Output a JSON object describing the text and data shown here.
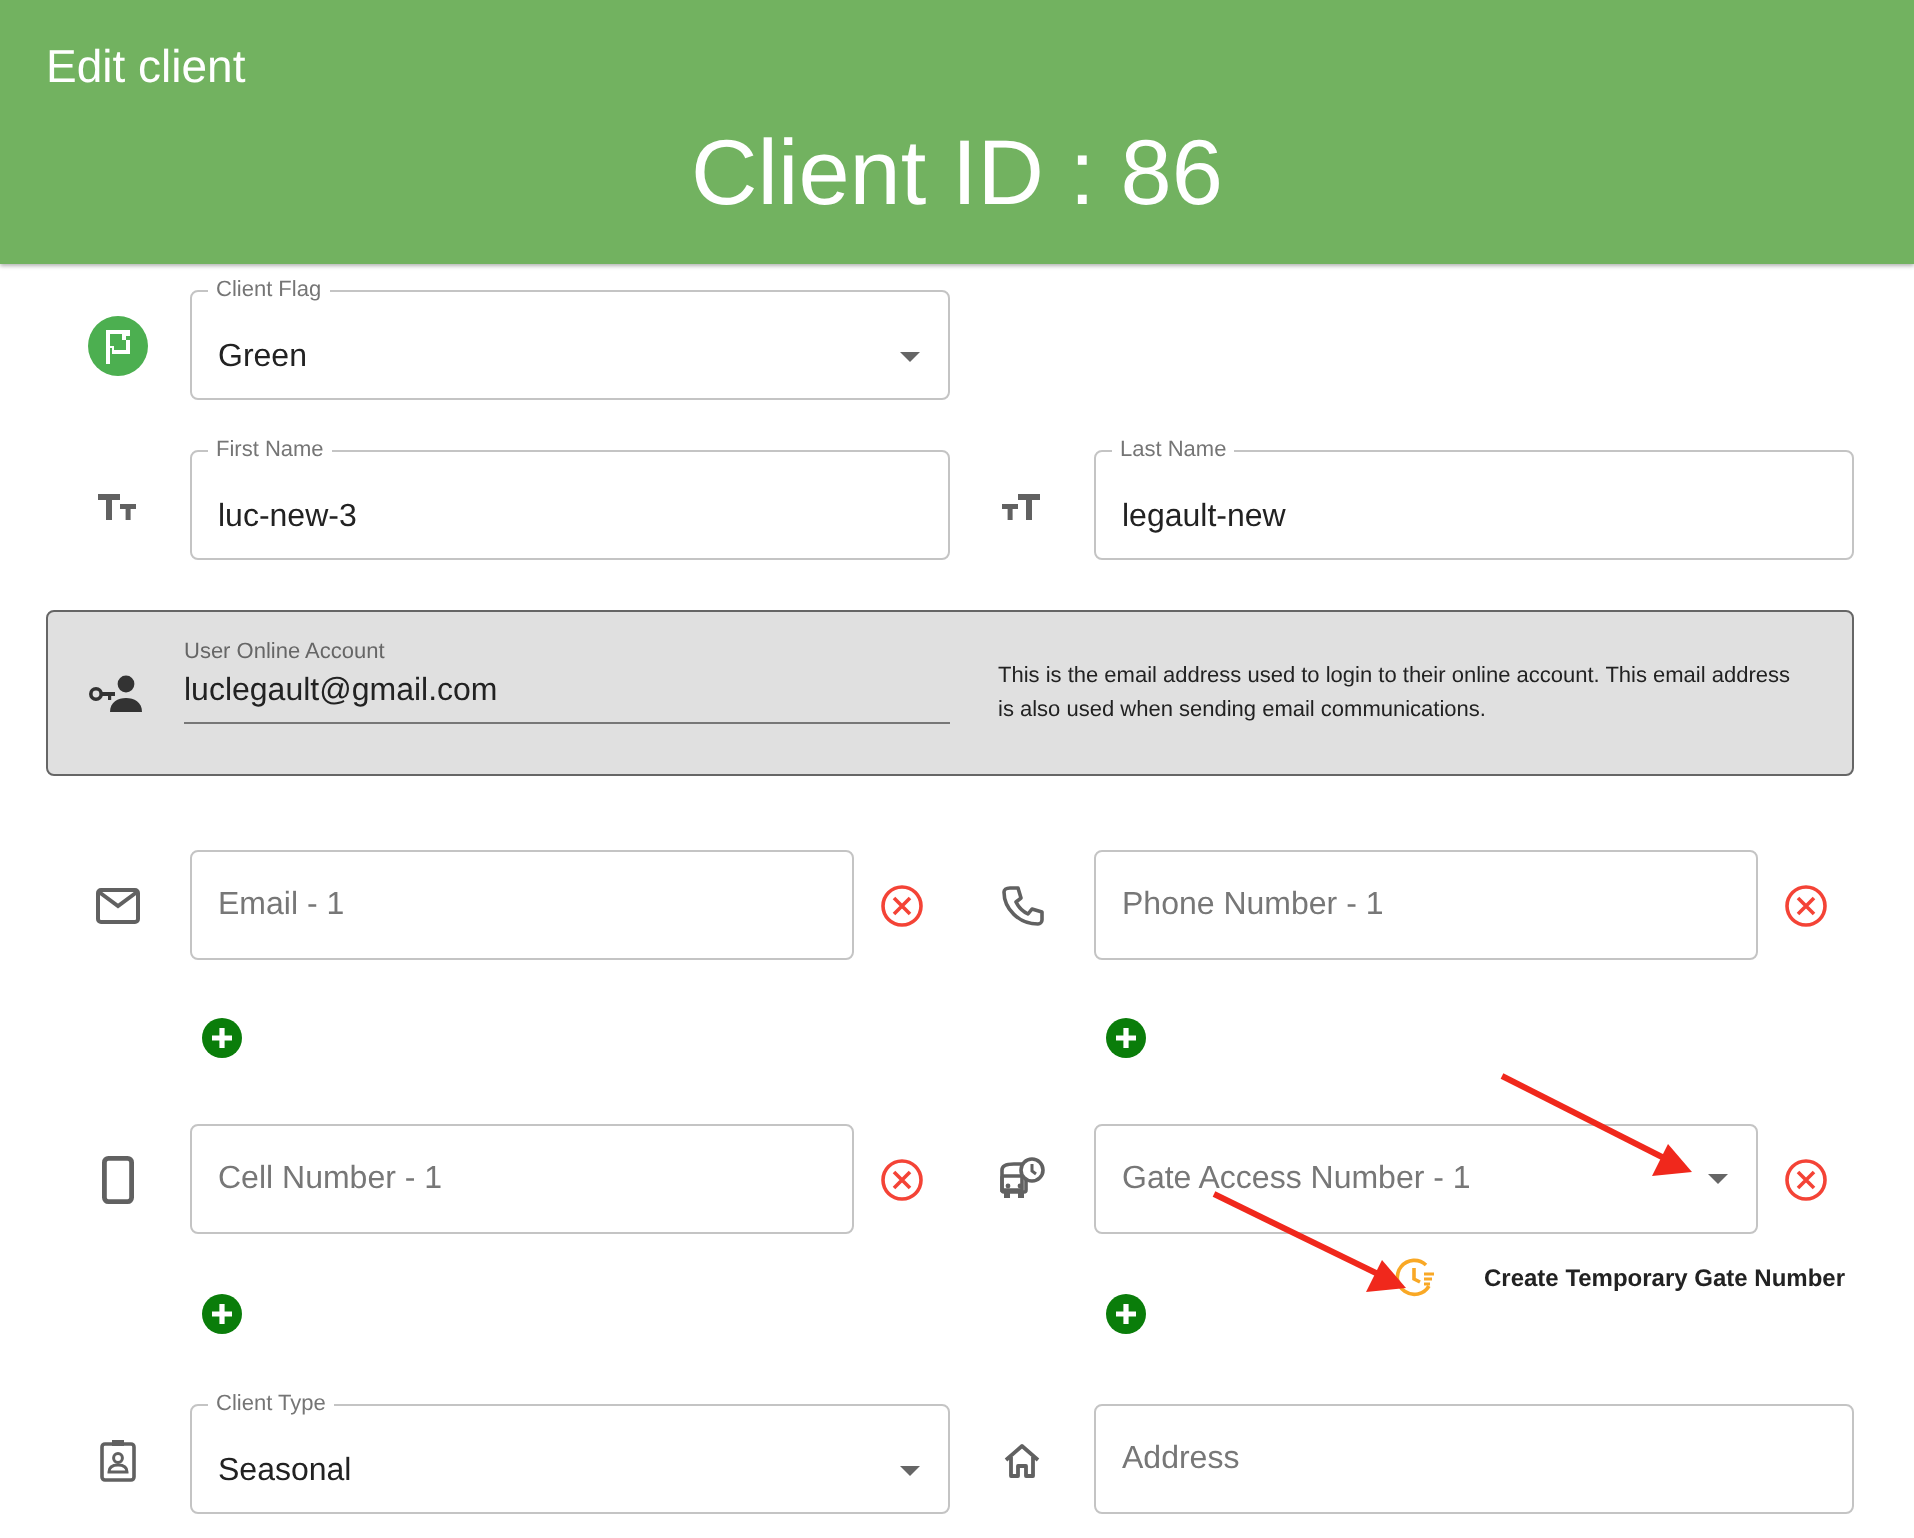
{
  "header": {
    "title": "Edit client",
    "heading": "Client ID : 86"
  },
  "client_flag": {
    "dropdown": true,
    "label": "Client Flag",
    "value": "Green"
  },
  "first_name": {
    "label": "First Name",
    "value": "luc-new-3"
  },
  "last_name": {
    "label": "Last Name",
    "value": "legault-new"
  },
  "online_account": {
    "label": "User Online Account",
    "value": "luclegault@gmail.com",
    "note": "This is the email address used to login to their online account. This email address is also used when sending email communications."
  },
  "email": {
    "placeholder": "Email - 1"
  },
  "phone": {
    "placeholder": "Phone Number - 1"
  },
  "cell": {
    "placeholder": "Cell Number - 1"
  },
  "gate_access": {
    "dropdown": true,
    "placeholder": "Gate Access Number - 1",
    "action": "Create Temporary Gate Number"
  },
  "client_type": {
    "dropdown": true,
    "label": "Client Type",
    "value": "Seasonal"
  },
  "address": {
    "placeholder": "Address"
  }
}
